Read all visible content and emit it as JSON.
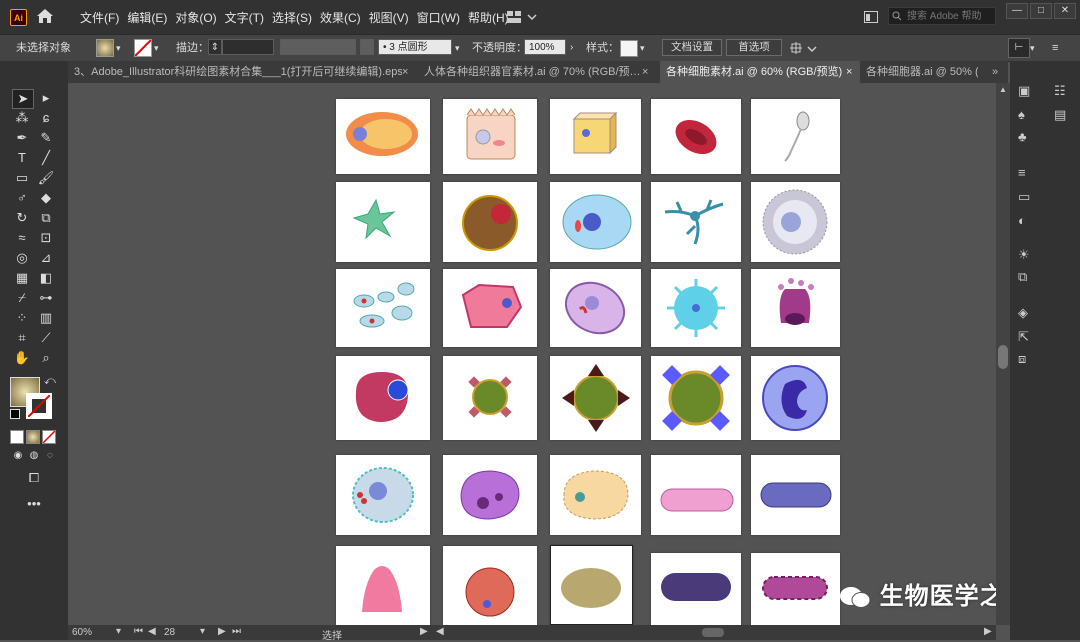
{
  "app": {
    "logo": "Ai"
  },
  "menu": [
    "文件(F)",
    "编辑(E)",
    "对象(O)",
    "文字(T)",
    "选择(S)",
    "效果(C)",
    "视图(V)",
    "窗口(W)",
    "帮助(H)"
  ],
  "search": {
    "placeholder": "搜索 Adobe 帮助"
  },
  "window_controls": {
    "minimize": "—",
    "maximize": "□",
    "close": "✕"
  },
  "control_bar": {
    "selection_status": "未选择对象",
    "stroke_label": "描边：",
    "brush_value": "3 点圆形",
    "opacity_label": "不透明度：",
    "opacity_value": "100%",
    "style_label": "样式：",
    "doc_setup": "文档设置",
    "preferences": "首选项"
  },
  "tabs": [
    {
      "label": "3、Adobe_Illustrator科研绘图素材合集___1(打开后可继续编辑).eps*",
      "active": false
    },
    {
      "label": "人体各种组织器官素材.ai @ 70% (RGB/预…",
      "active": false
    },
    {
      "label": "各种细胞素材.ai @ 60% (RGB/预览)",
      "active": true
    },
    {
      "label": "各种细胞器.ai @ 50% (",
      "active": false
    }
  ],
  "tab_close": "×",
  "tab_overflow": "»",
  "status": {
    "zoom": "60%",
    "page": "28",
    "mode": "选择"
  },
  "watermark": "生物医学之家",
  "colors": {
    "menubar": "#323232",
    "panel": "#323232",
    "canvas": "#535353",
    "accent": "#ff9a00"
  }
}
